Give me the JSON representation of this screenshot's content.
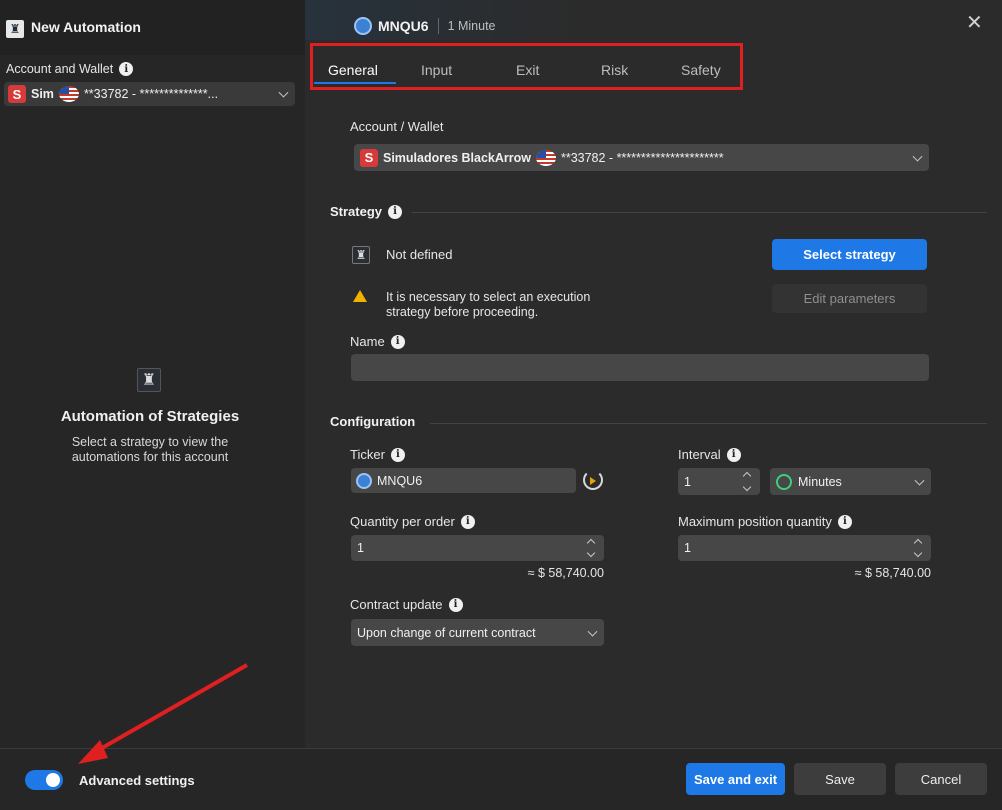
{
  "left_panel": {
    "title": "New Automation",
    "account_label": "Account and Wallet",
    "account_short": "Sim",
    "account_value": "**33782 - **************...",
    "empty_title": "Automation of Strategies",
    "empty_text": "Select a strategy to view the automations for this account"
  },
  "header": {
    "ticker": "MNQU6",
    "interval": "1 Minute"
  },
  "tabs": [
    "General",
    "Input",
    "Exit",
    "Risk",
    "Safety"
  ],
  "main": {
    "account_wallet_label": "Account / Wallet",
    "account_name": "Simuladores BlackArrow",
    "account_number": "**33782 - **********************",
    "strategy_section": "Strategy",
    "strategy_status": "Not defined",
    "select_strategy": "Select strategy",
    "edit_parameters": "Edit parameters",
    "warning": "It is necessary to select an execution strategy before proceeding.",
    "name_label": "Name",
    "name_value": "",
    "configuration_section": "Configuration",
    "ticker_label": "Ticker",
    "ticker_value": "MNQU6",
    "interval_label": "Interval",
    "interval_value": "1",
    "interval_unit": "Minutes",
    "qty_label": "Quantity per order",
    "qty_value": "1",
    "qty_approx": "≈ $ 58,740.00",
    "maxpos_label": "Maximum position quantity",
    "maxpos_value": "1",
    "maxpos_approx": "≈ $ 58,740.00",
    "contract_label": "Contract update",
    "contract_value": "Upon change of current contract"
  },
  "footer": {
    "advanced_settings": "Advanced settings",
    "advanced_enabled": true,
    "save_exit": "Save and exit",
    "save": "Save",
    "cancel": "Cancel"
  },
  "colors": {
    "accent": "#1e78e6",
    "annotation": "#e02020",
    "background": "#2b2b2b",
    "left_panel": "#252525"
  }
}
